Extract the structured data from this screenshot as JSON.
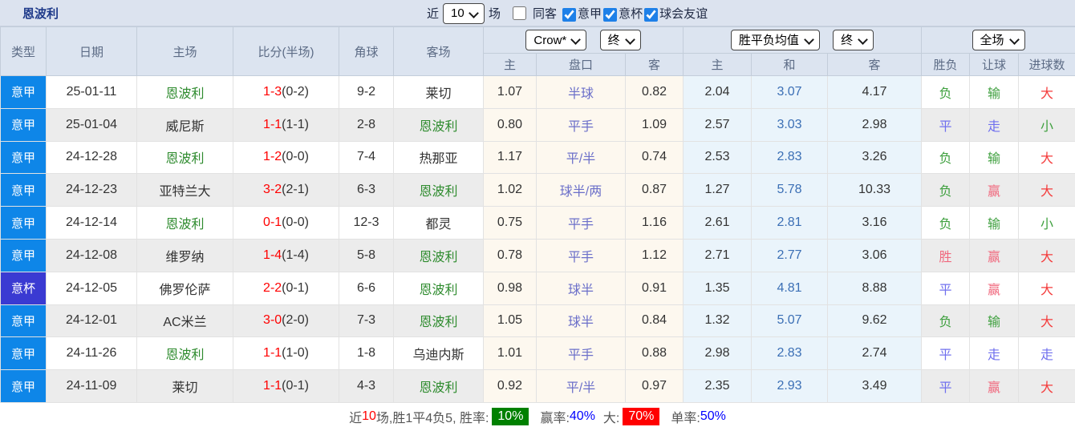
{
  "title": "恩波利",
  "controls": {
    "recent_label": "近",
    "count_value": "10",
    "matches_label": "场",
    "checkboxes": [
      {
        "label": "同客"
      },
      {
        "label": "意甲",
        "checked": "checked"
      },
      {
        "label": "意杯",
        "checked": "checked"
      },
      {
        "label": "球会友谊",
        "checked": "checked"
      }
    ]
  },
  "header": {
    "cols": [
      "类型",
      "日期",
      "主场",
      "比分(半场)",
      "角球",
      "客场"
    ],
    "odds_select": "Crow*",
    "odds_final_select": "终",
    "odds_sub": [
      "主",
      "盘口",
      "客"
    ],
    "avg_select": "胜平负均值",
    "avg_final_select": "终",
    "avg_sub": [
      "主",
      "和",
      "客"
    ],
    "result_select": "全场",
    "result_sub": [
      "胜负",
      "让球",
      "进球数"
    ]
  },
  "rows": [
    {
      "type": "意甲",
      "type_c": "serie",
      "date": "25-01-11",
      "home": "恩波利",
      "home_c": "self",
      "score": "1-3",
      "half": "(0-2)",
      "corner": "9-2",
      "away": "莱切",
      "away_c": "",
      "oh": "1.07",
      "line": "半球",
      "oa": "0.82",
      "eh": "2.04",
      "ed": "3.07",
      "ea": "4.17",
      "wdl": "负",
      "wdl_c": "green",
      "ah": "输",
      "ah_c": "green",
      "ou": "大",
      "ou_c": "red"
    },
    {
      "type": "意甲",
      "type_c": "serie",
      "date": "25-01-04",
      "home": "威尼斯",
      "home_c": "",
      "score": "1-1",
      "half": "(1-1)",
      "corner": "2-8",
      "away": "恩波利",
      "away_c": "self",
      "oh": "0.80",
      "line": "平手",
      "oa": "1.09",
      "eh": "2.57",
      "ed": "3.03",
      "ea": "2.98",
      "wdl": "平",
      "wdl_c": "blue",
      "ah": "走",
      "ah_c": "blue",
      "ou": "小",
      "ou_c": "green"
    },
    {
      "type": "意甲",
      "type_c": "serie",
      "date": "24-12-28",
      "home": "恩波利",
      "home_c": "self",
      "score": "1-2",
      "half": "(0-0)",
      "corner": "7-4",
      "away": "热那亚",
      "away_c": "",
      "oh": "1.17",
      "line": "平/半",
      "oa": "0.74",
      "eh": "2.53",
      "ed": "2.83",
      "ea": "3.26",
      "wdl": "负",
      "wdl_c": "green",
      "ah": "输",
      "ah_c": "green",
      "ou": "大",
      "ou_c": "red"
    },
    {
      "type": "意甲",
      "type_c": "serie",
      "date": "24-12-23",
      "home": "亚特兰大",
      "home_c": "",
      "score": "3-2",
      "half": "(2-1)",
      "corner": "6-3",
      "away": "恩波利",
      "away_c": "self",
      "oh": "1.02",
      "line": "球半/两",
      "oa": "0.87",
      "eh": "1.27",
      "ed": "5.78",
      "ea": "10.33",
      "wdl": "负",
      "wdl_c": "green",
      "ah": "赢",
      "ah_c": "pink",
      "ou": "大",
      "ou_c": "red"
    },
    {
      "type": "意甲",
      "type_c": "serie",
      "date": "24-12-14",
      "home": "恩波利",
      "home_c": "self",
      "score": "0-1",
      "half": "(0-0)",
      "corner": "12-3",
      "away": "都灵",
      "away_c": "",
      "oh": "0.75",
      "line": "平手",
      "oa": "1.16",
      "eh": "2.61",
      "ed": "2.81",
      "ea": "3.16",
      "wdl": "负",
      "wdl_c": "green",
      "ah": "输",
      "ah_c": "green",
      "ou": "小",
      "ou_c": "green"
    },
    {
      "type": "意甲",
      "type_c": "serie",
      "date": "24-12-08",
      "home": "维罗纳",
      "home_c": "",
      "score": "1-4",
      "half": "(1-4)",
      "corner": "5-8",
      "away": "恩波利",
      "away_c": "self",
      "oh": "0.78",
      "line": "平手",
      "oa": "1.12",
      "eh": "2.71",
      "ed": "2.77",
      "ea": "3.06",
      "wdl": "胜",
      "wdl_c": "pink",
      "ah": "赢",
      "ah_c": "pink",
      "ou": "大",
      "ou_c": "red"
    },
    {
      "type": "意杯",
      "type_c": "cup",
      "date": "24-12-05",
      "home": "佛罗伦萨",
      "home_c": "",
      "score": "2-2",
      "half": "(0-1)",
      "corner": "6-6",
      "away": "恩波利",
      "away_c": "self",
      "oh": "0.98",
      "line": "球半",
      "oa": "0.91",
      "eh": "1.35",
      "ed": "4.81",
      "ea": "8.88",
      "wdl": "平",
      "wdl_c": "blue",
      "ah": "赢",
      "ah_c": "pink",
      "ou": "大",
      "ou_c": "red"
    },
    {
      "type": "意甲",
      "type_c": "serie",
      "date": "24-12-01",
      "home": "AC米兰",
      "home_c": "",
      "score": "3-0",
      "half": "(2-0)",
      "corner": "7-3",
      "away": "恩波利",
      "away_c": "self",
      "oh": "1.05",
      "line": "球半",
      "oa": "0.84",
      "eh": "1.32",
      "ed": "5.07",
      "ea": "9.62",
      "wdl": "负",
      "wdl_c": "green",
      "ah": "输",
      "ah_c": "green",
      "ou": "大",
      "ou_c": "red"
    },
    {
      "type": "意甲",
      "type_c": "serie",
      "date": "24-11-26",
      "home": "恩波利",
      "home_c": "self",
      "score": "1-1",
      "half": "(1-0)",
      "corner": "1-8",
      "away": "乌迪内斯",
      "away_c": "",
      "oh": "1.01",
      "line": "平手",
      "oa": "0.88",
      "eh": "2.98",
      "ed": "2.83",
      "ea": "2.74",
      "wdl": "平",
      "wdl_c": "blue",
      "ah": "走",
      "ah_c": "blue",
      "ou": "走",
      "ou_c": "blue"
    },
    {
      "type": "意甲",
      "type_c": "serie",
      "date": "24-11-09",
      "home": "莱切",
      "home_c": "",
      "score": "1-1",
      "half": "(0-1)",
      "corner": "4-3",
      "away": "恩波利",
      "away_c": "self",
      "oh": "0.92",
      "line": "平/半",
      "oa": "0.97",
      "eh": "2.35",
      "ed": "2.93",
      "ea": "3.49",
      "wdl": "平",
      "wdl_c": "blue",
      "ah": "赢",
      "ah_c": "pink",
      "ou": "大",
      "ou_c": "red"
    }
  ],
  "summary": {
    "pre1": "近",
    "n": "10",
    "pre2": "场,胜1平4负5, 胜率:",
    "win_rate": "10%",
    "label_win": "赢率:",
    "win_pct": "40%",
    "label_big": "大:",
    "big_pct": "70%",
    "label_single": "单率:",
    "single_pct": "50%"
  },
  "colors": {
    "league_serie_a": "#0e86e8",
    "league_cup": "#3a3ad2",
    "team_self_green": "#2e8b2e",
    "score_red": "#ff0000",
    "handicap_text": "#6b6fc9",
    "avg_draw_blue": "#3b6fb5",
    "result_green": "#3fa03f",
    "result_blue": "#7070ee",
    "result_pink": "#f0697e",
    "result_red": "#f43b3b",
    "badge_green": "#008000",
    "badge_red": "#ff0000",
    "header_bg": "#dce4f0",
    "odds_bg": "#fdf8ef",
    "avg_bg": "#eaf4fb"
  }
}
